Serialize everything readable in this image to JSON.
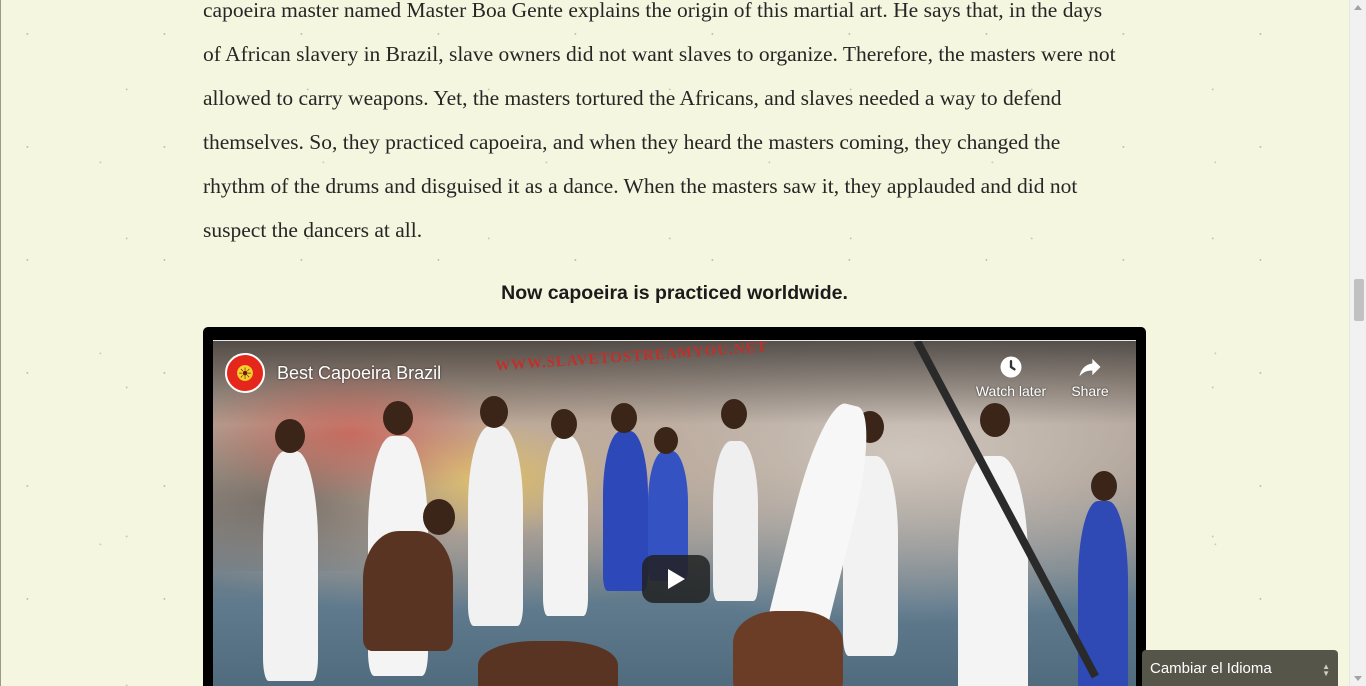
{
  "article": {
    "lines": [
      "capoeira master named Master Boa Gente explains the origin of this martial art. He says that, in the days",
      "of African slavery in Brazil, slave owners did not want slaves to organize. Therefore, the masters were not",
      "allowed to carry weapons. Yet, the masters tortured the Africans, and slaves needed a way to defend",
      "themselves. So, they practiced capoeira, and when they heard the masters coming, they changed the",
      "rhythm of the drums and disguised it as a dance. When the masters saw it, they applauded and did not",
      "suspect the dancers at all."
    ],
    "caption": "Now capoeira is practiced worldwide."
  },
  "video": {
    "channel_title": "Best Capoeira Brazil",
    "channel_logo_icon": "capoeira-channel-logo",
    "watch_later_label": "Watch later",
    "share_label": "Share",
    "graffiti_text": "WWW.SLAVETOSTREAMYOU.NET",
    "play_icon": "play-icon"
  },
  "language_widget": {
    "label": "Cambiar el Idioma",
    "background": "#55554a"
  },
  "colors": {
    "page_background": "#f5f6df",
    "text": "#262626",
    "video_frame": "#000000"
  }
}
